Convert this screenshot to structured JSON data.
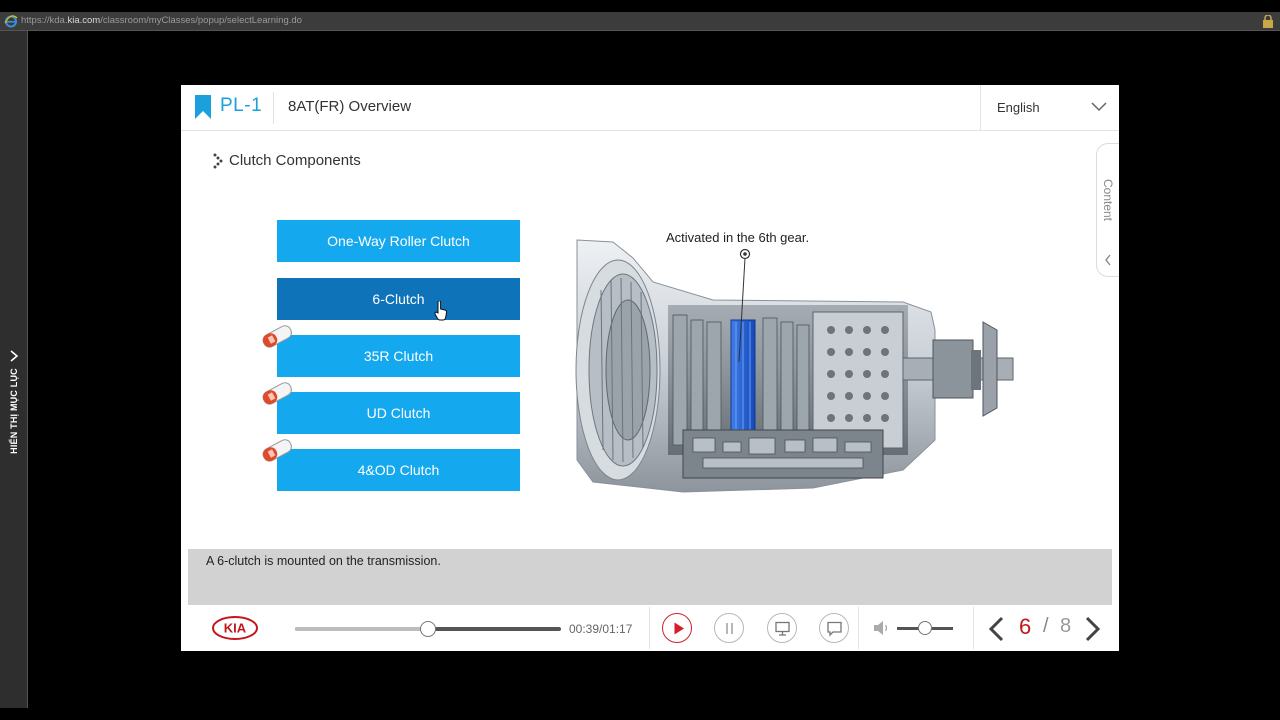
{
  "browser": {
    "url_prefix": "https://kda.",
    "url_host": "kia.com",
    "url_path": "/classroom/myClasses/popup/selectLearning.do",
    "icons": [
      "ie-icon",
      "lock-icon"
    ]
  },
  "sidebar": {
    "toggle_label": "HIỂN THỊ MỤC LỤC"
  },
  "header": {
    "course_code": "PL-1",
    "course_title": "8AT(FR) Overview",
    "language": "English"
  },
  "section_title": "Clutch Components",
  "clutches": [
    {
      "label": "One-Way Roller Clutch",
      "active": false,
      "marker": false
    },
    {
      "label": "6-Clutch",
      "active": true,
      "marker": false
    },
    {
      "label": "35R Clutch",
      "active": false,
      "marker": true
    },
    {
      "label": "UD Clutch",
      "active": false,
      "marker": true
    },
    {
      "label": "4&OD Clutch",
      "active": false,
      "marker": true
    }
  ],
  "diagram_note": "Activated in the 6th gear.",
  "content_tab_label": "Content",
  "caption": "A 6-clutch is mounted on the transmission.",
  "player": {
    "brand": "KIA",
    "time_display": "00:39/01:17",
    "progress": 0.5,
    "volume": 0.5,
    "current_page": "6",
    "separator": "/",
    "total_pages": "8"
  },
  "colors": {
    "accent_blue": "#14a8ef",
    "active_blue": "#0f73ba",
    "course_code_blue": "#1aa0dc",
    "play_red": "#d21f2b",
    "page_red": "#c4161c",
    "highlight_blue": "#1e62d8"
  }
}
